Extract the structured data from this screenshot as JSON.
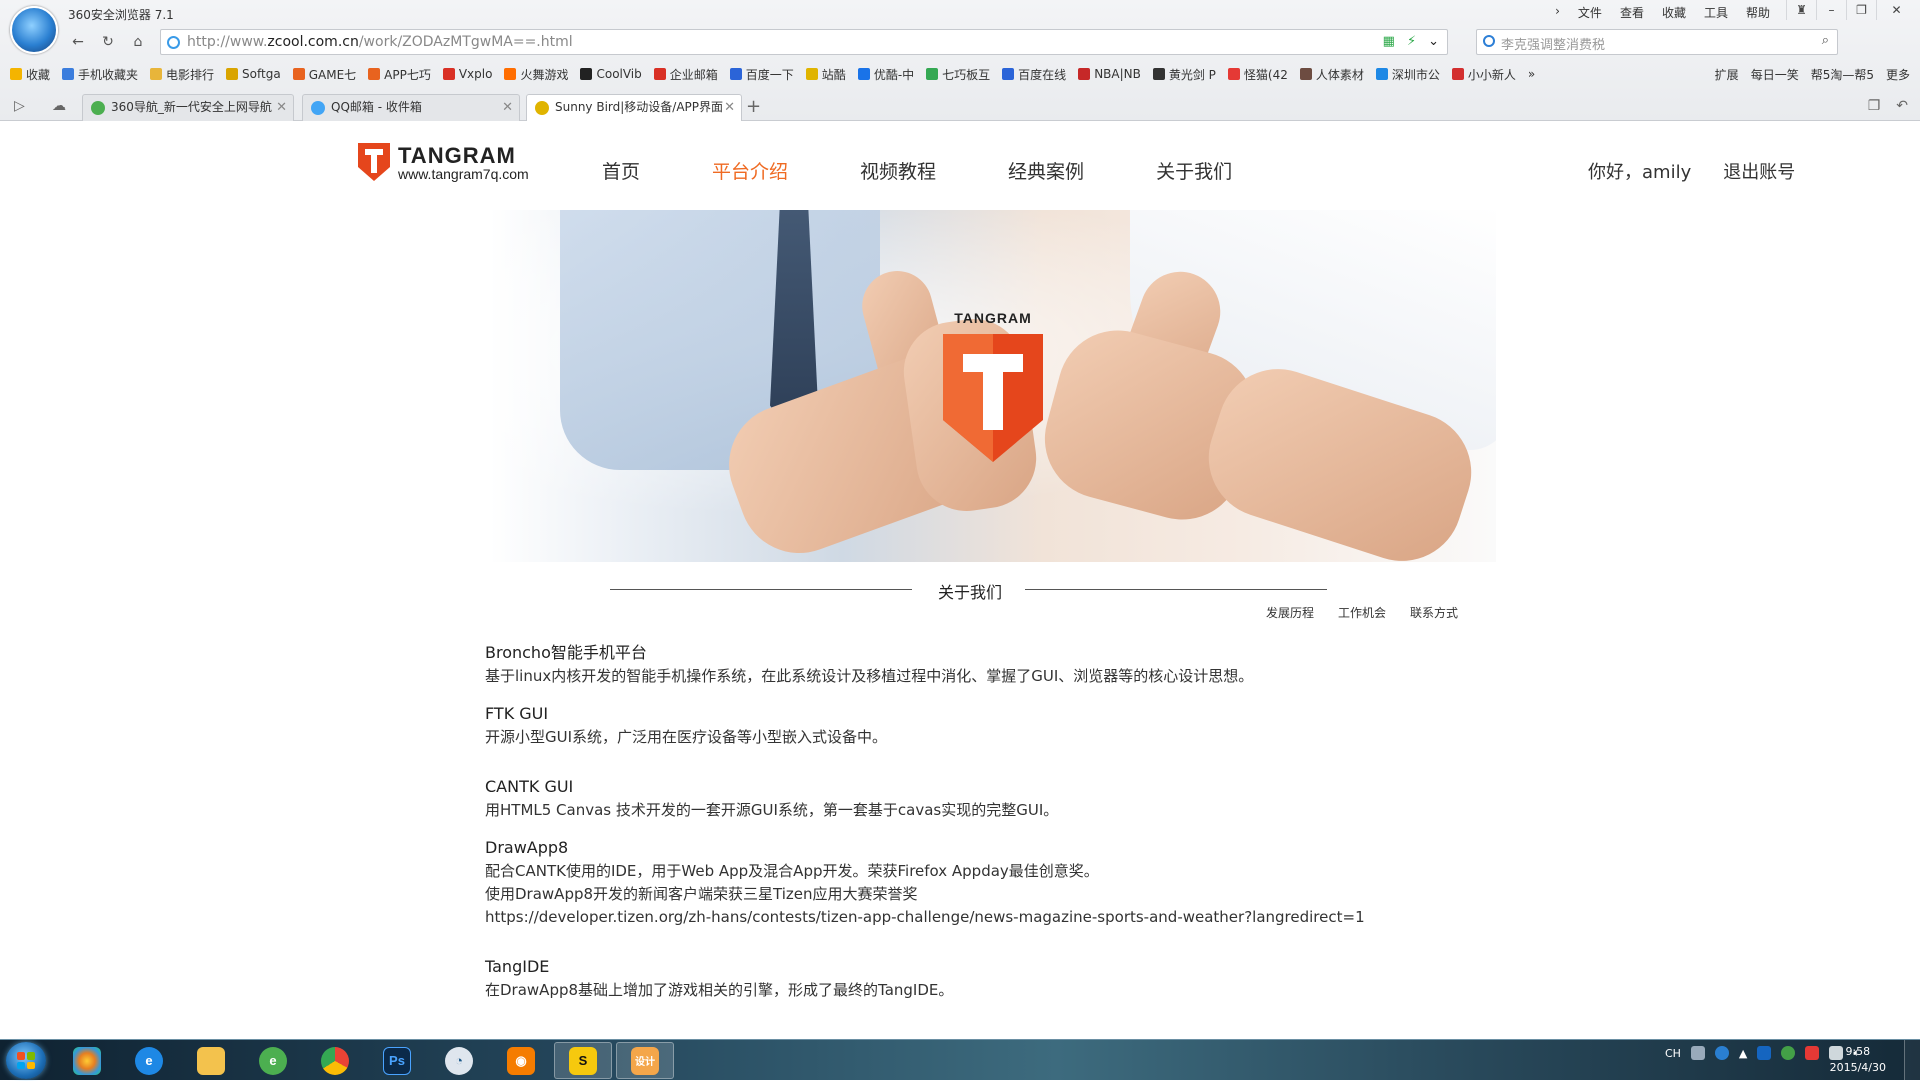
{
  "browser": {
    "app_title": "360安全浏览器 7.1",
    "menu": [
      "文件",
      "查看",
      "收藏",
      "工具",
      "帮助"
    ],
    "url_prefix": "http://www.",
    "url_domain": "zcool.com.cn",
    "url_path": "/work/ZODAzMTgwMA==.html",
    "search_placeholder": "李克强调整消费税",
    "bookmarks": [
      {
        "label": "收藏",
        "color": "#f4b400"
      },
      {
        "label": "手机收藏夹",
        "color": "#3b7ddd"
      },
      {
        "label": "电影排行",
        "color": "#e8b53a"
      },
      {
        "label": "Softga",
        "color": "#d9a400"
      },
      {
        "label": "GAME七",
        "color": "#e8631f"
      },
      {
        "label": "APP七巧",
        "color": "#e8631f"
      },
      {
        "label": "Vxplo",
        "color": "#d93025"
      },
      {
        "label": "火舞游戏",
        "color": "#ff6d00"
      },
      {
        "label": "CoolVib",
        "color": "#222222"
      },
      {
        "label": "企业邮箱",
        "color": "#d93025"
      },
      {
        "label": "百度一下",
        "color": "#2b64d8"
      },
      {
        "label": "站酷",
        "color": "#e0b400"
      },
      {
        "label": "优酷-中",
        "color": "#1a73e8"
      },
      {
        "label": "七巧板互",
        "color": "#34a853"
      },
      {
        "label": "百度在线",
        "color": "#2b64d8"
      },
      {
        "label": "NBA|NB",
        "color": "#c62828"
      },
      {
        "label": "黄光剑 P",
        "color": "#333333"
      },
      {
        "label": "怪猫(42",
        "color": "#e53935"
      },
      {
        "label": "人体素材",
        "color": "#6d4c41"
      },
      {
        "label": "深圳市公",
        "color": "#1e88e5"
      },
      {
        "label": "小小新人",
        "color": "#d32f2f"
      }
    ],
    "bookmarks_right": [
      "扩展",
      "每日一笑",
      "帮5淘—帮5",
      "更多"
    ],
    "tabs": [
      {
        "label": "360导航_新一代安全上网导航",
        "color": "#4caf50"
      },
      {
        "label": "QQ邮箱 - 收件箱",
        "color": "#42a5f5"
      },
      {
        "label": "Sunny Bird|移动设备/APP界面",
        "color": "#e0b400"
      }
    ]
  },
  "site": {
    "logo_name": "TANGRAM",
    "logo_url": "www.tangram7q.com",
    "nav": [
      "首页",
      "平台介绍",
      "视频教程",
      "经典案例",
      "关于我们"
    ],
    "greeting": "你好，amily",
    "logout": "退出账号",
    "banner_logo_name": "TANGRAM",
    "section_title": "关于我们",
    "subnav": [
      "发展历程",
      "工作机会",
      "联系方式"
    ],
    "items": [
      {
        "title": "Broncho智能手机平台",
        "lines": [
          "基于linux内核开发的智能手机操作系统，在此系统设计及移植过程中消化、掌握了GUI、浏览器等的核心设计思想。"
        ]
      },
      {
        "title": "FTK GUI",
        "lines": [
          "开源小型GUI系统，广泛用在医疗设备等小型嵌入式设备中。"
        ]
      },
      {
        "title": "CANTK GUI",
        "lines": [
          "用HTML5 Canvas 技术开发的一套开源GUI系统，第一套基于cavas实现的完整GUI。"
        ]
      },
      {
        "title": "DrawApp8",
        "lines": [
          "配合CANTK使用的IDE，用于Web App及混合App开发。荣获Firefox Appday最佳创意奖。",
          "使用DrawApp8开发的新闻客户端荣获三星Tizen应用大赛荣誉奖",
          "https://developer.tizen.org/zh-hans/contests/tizen-app-challenge/news-magazine-sports-and-weather?langredirect=1"
        ]
      },
      {
        "title": "TangIDE",
        "lines": [
          "在DrawApp8基础上增加了游戏相关的引擎，形成了最终的TangIDE。"
        ]
      }
    ]
  },
  "taskbar": {
    "tray_lang": "CH",
    "time": "9:58",
    "date": "2015/4/30"
  },
  "colors": {
    "accent": "#ef6a22",
    "logo_red": "#e5461c"
  }
}
